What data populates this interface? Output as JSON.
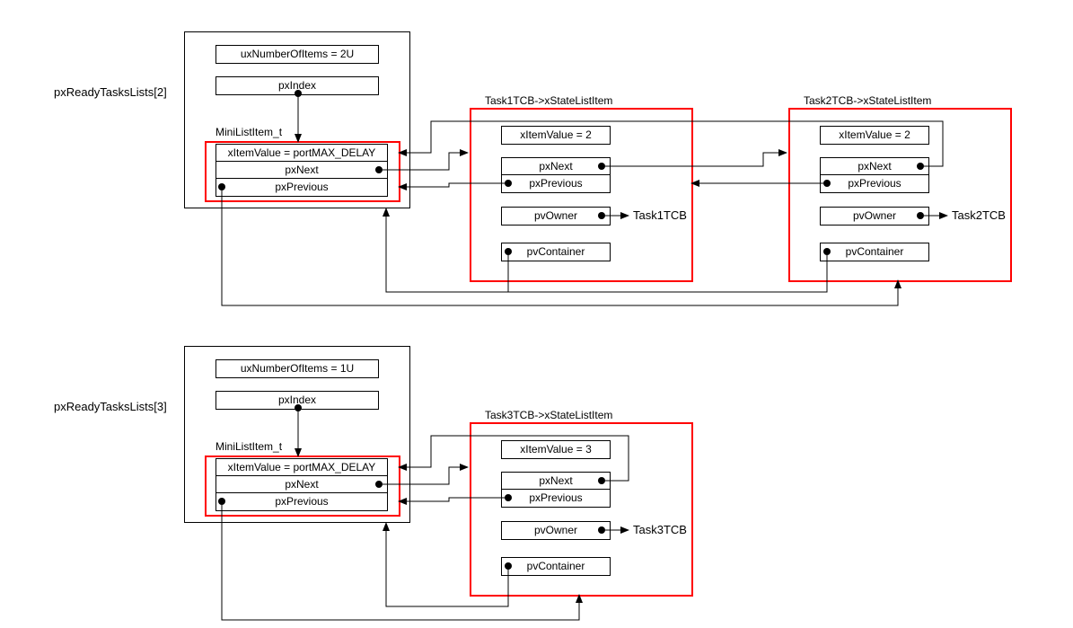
{
  "list2": {
    "title": "pxReadyTasksLists[2]",
    "uxNumberOfItems": "uxNumberOfItems = 2U",
    "pxIndex": "pxIndex",
    "miniLabel": "MiniListItem_t",
    "xItemValue": "xItemValue = portMAX_DELAY",
    "pxNext": "pxNext",
    "pxPrevious": "pxPrevious"
  },
  "task1": {
    "title": "Task1TCB->xStateListItem",
    "xItemValue": "xItemValue = 2",
    "pxNext": "pxNext",
    "pxPrevious": "pxPrevious",
    "pvOwner": "pvOwner",
    "pvContainer": "pvContainer",
    "ownerTarget": "Task1TCB"
  },
  "task2": {
    "title": "Task2TCB->xStateListItem",
    "xItemValue": "xItemValue = 2",
    "pxNext": "pxNext",
    "pxPrevious": "pxPrevious",
    "pvOwner": "pvOwner",
    "pvContainer": "pvContainer",
    "ownerTarget": "Task2TCB"
  },
  "list3": {
    "title": "pxReadyTasksLists[3]",
    "uxNumberOfItems": "uxNumberOfItems = 1U",
    "pxIndex": "pxIndex",
    "miniLabel": "MiniListItem_t",
    "xItemValue": "xItemValue = portMAX_DELAY",
    "pxNext": "pxNext",
    "pxPrevious": "pxPrevious"
  },
  "task3": {
    "title": "Task3TCB->xStateListItem",
    "xItemValue": "xItemValue = 3",
    "pxNext": "pxNext",
    "pxPrevious": "pxPrevious",
    "pvOwner": "pvOwner",
    "pvContainer": "pvContainer",
    "ownerTarget": "Task3TCB"
  }
}
